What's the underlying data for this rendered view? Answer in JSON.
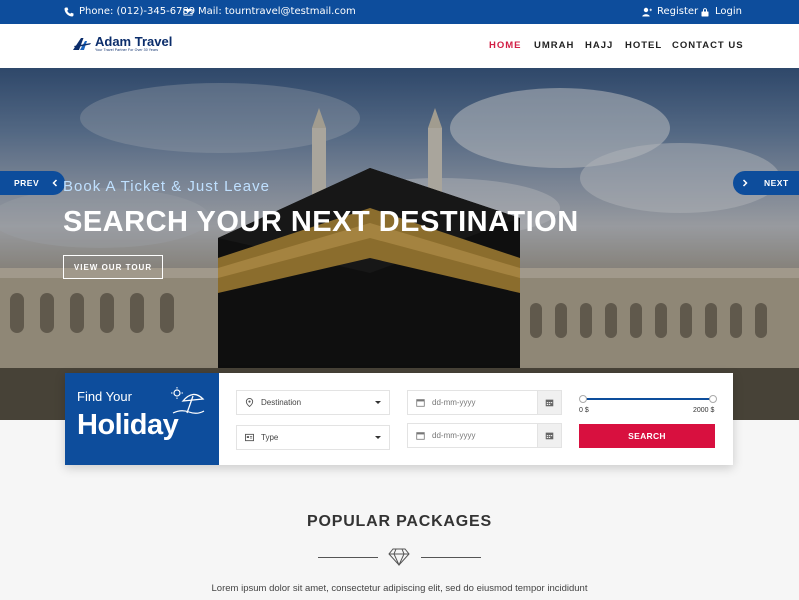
{
  "topbar": {
    "phone": "Phone: (012)-345-6789",
    "mail": "Mail: tourntravel@testmail.com",
    "register": "Register",
    "login": "Login"
  },
  "logo": {
    "name": "Adam Travel",
    "tagline": "Your Travel Partner For Over 30 Years"
  },
  "menu": {
    "home": "HOME",
    "umrah": "UMRAH",
    "hajj": "HAJJ",
    "hotel": "HOTEL",
    "contact": "CONTACT US"
  },
  "hero": {
    "prev": "PREV",
    "next": "NEXT",
    "subtitle": "Book A Ticket & Just Leave",
    "title": "SEARCH YOUR NEXT DESTINATION",
    "cta": "VIEW OUR TOUR"
  },
  "search": {
    "find": "Find Your",
    "holiday": "Holiday",
    "destination": "Destination",
    "type": "Type",
    "date_placeholder": "dd-mm-yyyy",
    "price_min": "0 $",
    "price_max": "2000 $",
    "button": "SEARCH"
  },
  "packages": {
    "title": "POPULAR PACKAGES",
    "text": "Lorem ipsum dolor sit amet, consectetur adipiscing elit, sed do eiusmod tempor incididunt"
  },
  "colors": {
    "primary": "#0d4d9c",
    "accent": "#d8103f"
  }
}
